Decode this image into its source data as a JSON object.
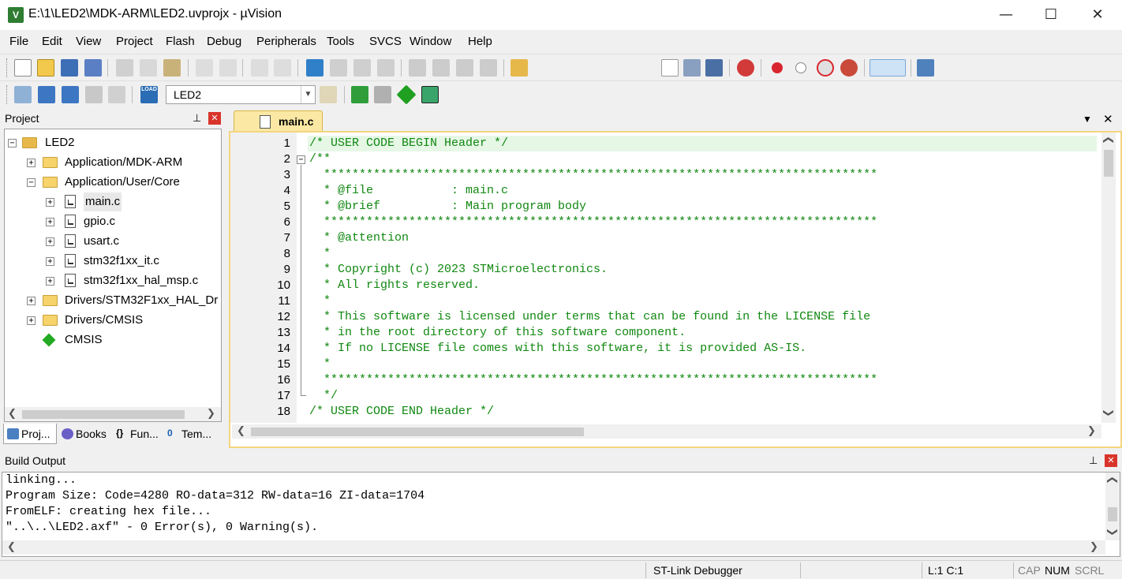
{
  "window": {
    "title": "E:\\1\\LED2\\MDK-ARM\\LED2.uvprojx - µVision",
    "app_icon_letter": "V",
    "minimize": "—",
    "maximize": "☐",
    "close": "✕"
  },
  "menu": [
    "File",
    "Edit",
    "View",
    "Project",
    "Flash",
    "Debug",
    "Peripherals",
    "Tools",
    "SVCS",
    "Window",
    "Help"
  ],
  "toolbar2": {
    "target": "LED2",
    "load_label": "LOAD"
  },
  "project_pane": {
    "title": "Project",
    "pin": "№",
    "close": "✕",
    "tree": [
      {
        "label": "LED2"
      },
      {
        "label": "Application/MDK-ARM"
      },
      {
        "label": "Application/User/Core"
      },
      {
        "label": "main.c"
      },
      {
        "label": "gpio.c"
      },
      {
        "label": "usart.c"
      },
      {
        "label": "stm32f1xx_it.c"
      },
      {
        "label": "stm32f1xx_hal_msp.c"
      },
      {
        "label": "Drivers/STM32F1xx_HAL_Dr"
      },
      {
        "label": "Drivers/CMSIS"
      },
      {
        "label": "CMSIS"
      }
    ],
    "tabs": [
      "Proj...",
      "Books",
      "Fun...",
      "Tem..."
    ]
  },
  "editor": {
    "tab": "main.c",
    "lines": [
      {
        "n": "1",
        "text": "/* USER CODE BEGIN Header */"
      },
      {
        "n": "2",
        "text": "/**"
      },
      {
        "n": "3",
        "text": "  ******************************************************************************"
      },
      {
        "n": "4",
        "text": "  * @file           : main.c"
      },
      {
        "n": "5",
        "text": "  * @brief          : Main program body"
      },
      {
        "n": "6",
        "text": "  ******************************************************************************"
      },
      {
        "n": "7",
        "text": "  * @attention"
      },
      {
        "n": "8",
        "text": "  *"
      },
      {
        "n": "9",
        "text": "  * Copyright (c) 2023 STMicroelectronics."
      },
      {
        "n": "10",
        "text": "  * All rights reserved."
      },
      {
        "n": "11",
        "text": "  *"
      },
      {
        "n": "12",
        "text": "  * This software is licensed under terms that can be found in the LICENSE file"
      },
      {
        "n": "13",
        "text": "  * in the root directory of this software component."
      },
      {
        "n": "14",
        "text": "  * If no LICENSE file comes with this software, it is provided AS-IS."
      },
      {
        "n": "15",
        "text": "  *"
      },
      {
        "n": "16",
        "text": "  ******************************************************************************"
      },
      {
        "n": "17",
        "text": "  */"
      },
      {
        "n": "18",
        "text": "/* USER CODE END Header */"
      }
    ]
  },
  "build_output": {
    "title": "Build Output",
    "lines": [
      "linking...",
      "Program Size: Code=4280 RO-data=312 RW-data=16 ZI-data=1704",
      "FromELF: creating hex file...",
      "\"..\\..\\LED2.axf\" - 0 Error(s), 0 Warning(s)."
    ]
  },
  "statusbar": {
    "debugger": "ST-Link Debugger",
    "position": "L:1 C:1",
    "cap": "CAP",
    "num": "NUM",
    "scrl": "SCRL"
  },
  "colors": {
    "comment_green": "#118811",
    "tab_yellow": "#fbe8a4",
    "frame_yellow": "#f3d57f",
    "current_line": "#e6f7e6"
  }
}
